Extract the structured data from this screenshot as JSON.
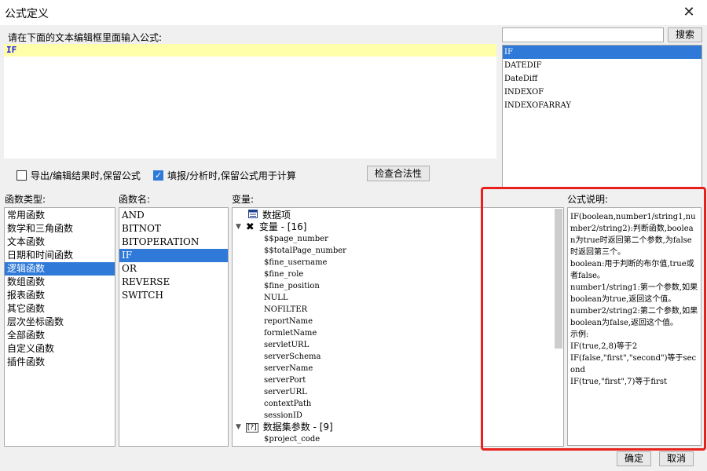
{
  "window": {
    "title": "公式定义",
    "close_glyph": "✕"
  },
  "editor": {
    "hint": "请在下面的文本编辑框里面输入公式:",
    "content": "IF"
  },
  "search": {
    "button": "搜索",
    "value": "",
    "results": [
      "IF",
      "DATEDIF",
      "DateDiff",
      "INDEXOF",
      "INDEXOFARRAY"
    ],
    "selected": 0
  },
  "options": {
    "keep_formula_export": {
      "label": "导出/编辑结果时,保留公式",
      "checked": false
    },
    "keep_formula_calc": {
      "label": "填报/分析时,保留公式用于计算",
      "checked": true
    },
    "validate_button": "检查合法性"
  },
  "function_types": {
    "header": "函数类型:",
    "items": [
      "常用函数",
      "数学和三角函数",
      "文本函数",
      "日期和时间函数",
      "逻辑函数",
      "数组函数",
      "报表函数",
      "其它函数",
      "层次坐标函数",
      "全部函数",
      "自定义函数",
      "插件函数"
    ],
    "selected": 4
  },
  "function_names": {
    "header": "函数名:",
    "items": [
      "AND",
      "BITNOT",
      "BITOPERATION",
      "IF",
      "OR",
      "REVERSE",
      "SWITCH"
    ],
    "selected": 3
  },
  "variables": {
    "header": "变量:",
    "data_item": "数据项",
    "variable_group": "变量 - [16]",
    "variable_items": [
      "$$page_number",
      "$$totalPage_number",
      "$fine_username",
      "$fine_role",
      "$fine_position",
      "NULL",
      "NOFILTER",
      "reportName",
      "formletName",
      "servletURL",
      "serverSchema",
      "serverName",
      "serverPort",
      "serverURL",
      "contextPath",
      "sessionID"
    ],
    "dataset_group": "数据集参数 - [9]",
    "dataset_items": [
      "$project_code"
    ]
  },
  "description": {
    "header": "公式说明:",
    "lines": [
      "IF(boolean,number1/string1,number2/string2):判断函数,boolean为true时返回第二个参数,为false时返回第三个。",
      "boolean:用于判断的布尔值,true或者false。",
      "number1/string1:第一个参数,如果boolean为true,返回这个值。",
      "number2/string2:第二个参数,如果boolean为false,返回这个值。",
      "示例:",
      "IF(true,2,8)等于2",
      "IF(false,\"first\",\"second\")等于second",
      "IF(true,\"first\",7)等于first"
    ]
  },
  "footer": {
    "ok": "确定",
    "cancel": "取消"
  },
  "colors": {
    "selection": "#2f7ad8",
    "highlight_box": "#e8211d",
    "editor_line": "#ffffaa"
  }
}
